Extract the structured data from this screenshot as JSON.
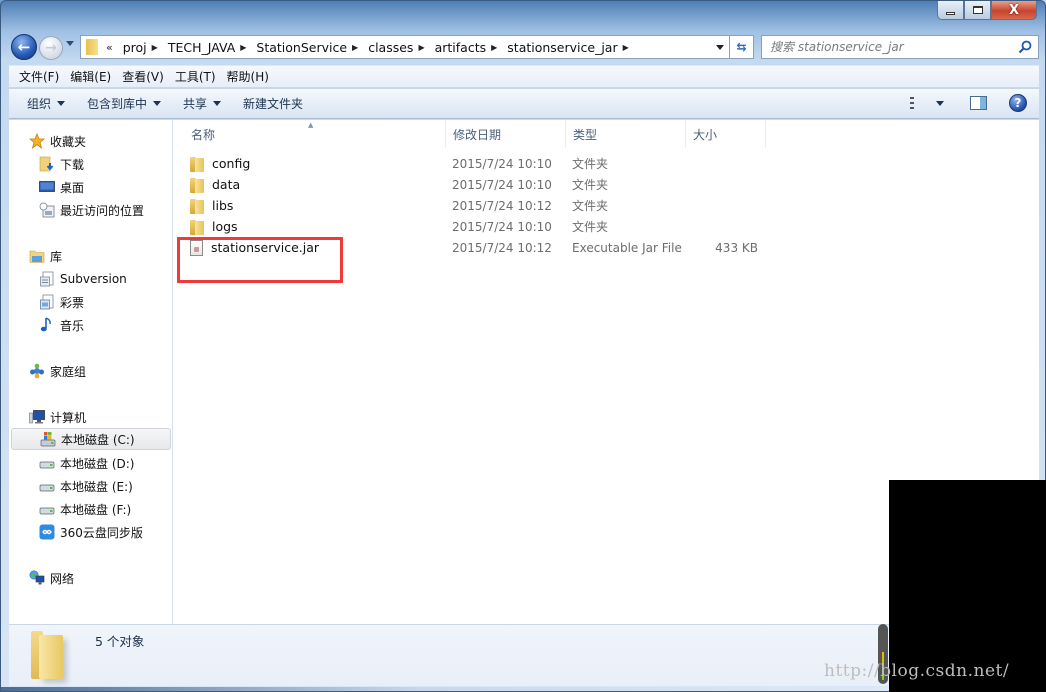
{
  "window": {
    "caption_buttons": {
      "minimize": "minimize",
      "maximize": "maximize",
      "close": "X"
    }
  },
  "nav": {
    "back_icon": "arrow-left-icon",
    "forward_icon": "arrow-right-icon",
    "overflow": "«",
    "breadcrumbs": [
      {
        "label": "proj"
      },
      {
        "label": "TECH_JAVA"
      },
      {
        "label": "StationService"
      },
      {
        "label": "classes"
      },
      {
        "label": "artifacts"
      },
      {
        "label": "stationservice_jar"
      }
    ],
    "separator": "▶",
    "refresh_glyph": "⇆",
    "search_placeholder": "搜索 stationservice_jar"
  },
  "menubar": {
    "items": [
      {
        "label": "文件(F)"
      },
      {
        "label": "编辑(E)"
      },
      {
        "label": "查看(V)"
      },
      {
        "label": "工具(T)"
      },
      {
        "label": "帮助(H)"
      }
    ]
  },
  "commandbar": {
    "items": [
      {
        "label": "组织",
        "has_dropdown": true
      },
      {
        "label": "包含到库中",
        "has_dropdown": true
      },
      {
        "label": "共享",
        "has_dropdown": true
      },
      {
        "label": "新建文件夹",
        "has_dropdown": false
      }
    ],
    "help_glyph": "?"
  },
  "sidebar": {
    "favorites": {
      "label": "收藏夹",
      "icon": "star-icon"
    },
    "favorites_items": [
      {
        "label": "下载",
        "icon": "downloads-folder-icon"
      },
      {
        "label": "桌面",
        "icon": "desktop-icon"
      },
      {
        "label": "最近访问的位置",
        "icon": "recent-places-icon"
      }
    ],
    "libraries": {
      "label": "库",
      "icon": "library-icon"
    },
    "libraries_items": [
      {
        "label": "Subversion",
        "icon": "document-library-icon"
      },
      {
        "label": "彩票",
        "icon": "document-library-icon"
      },
      {
        "label": "音乐",
        "icon": "music-icon"
      }
    ],
    "homegroup": {
      "label": "家庭组",
      "icon": "homegroup-icon"
    },
    "computer": {
      "label": "计算机",
      "icon": "computer-icon"
    },
    "computer_items": [
      {
        "label": "本地磁盘 (C:)",
        "icon": "system-drive-icon",
        "selected": true
      },
      {
        "label": "本地磁盘 (D:)",
        "icon": "drive-icon"
      },
      {
        "label": "本地磁盘 (E:)",
        "icon": "drive-icon"
      },
      {
        "label": "本地磁盘 (F:)",
        "icon": "drive-icon"
      },
      {
        "label": "360云盘同步版",
        "icon": "cloud-sync-icon"
      }
    ],
    "network": {
      "label": "网络",
      "icon": "network-icon"
    }
  },
  "files": {
    "columns": [
      {
        "label": "名称"
      },
      {
        "label": "修改日期"
      },
      {
        "label": "类型"
      },
      {
        "label": "大小"
      }
    ],
    "sort_indicator": "▲",
    "rows": [
      {
        "name": "config",
        "date": "2015/7/24 10:10",
        "type": "文件夹",
        "size": "",
        "kind": "folder"
      },
      {
        "name": "data",
        "date": "2015/7/24 10:10",
        "type": "文件夹",
        "size": "",
        "kind": "folder"
      },
      {
        "name": "libs",
        "date": "2015/7/24 10:12",
        "type": "文件夹",
        "size": "",
        "kind": "folder"
      },
      {
        "name": "logs",
        "date": "2015/7/24 10:10",
        "type": "文件夹",
        "size": "",
        "kind": "folder"
      },
      {
        "name": "stationservice.jar",
        "date": "2015/7/24 10:12",
        "type": "Executable Jar File",
        "size": "433 KB",
        "kind": "jar"
      }
    ],
    "highlight_color": "#f03a3a"
  },
  "details": {
    "count_text": "5 个对象"
  },
  "watermark": "http://blog.csdn.net/"
}
